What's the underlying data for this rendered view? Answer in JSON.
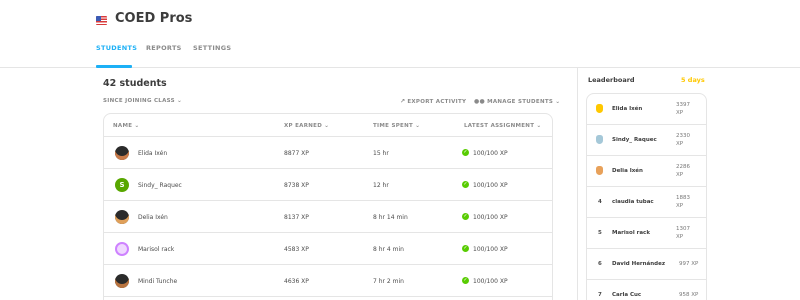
{
  "header": {
    "class_name": "COED Pros",
    "flag_icon": "us-flag-icon",
    "tabs": [
      "STUDENTS",
      "REPORTS",
      "SETTINGS"
    ],
    "active_tab": "STUDENTS"
  },
  "main": {
    "student_count": "42 students",
    "filter_label": "SINCE JOINING CLASS",
    "export_label": "EXPORT ACTIVITY",
    "manage_label": "MANAGE STUDENTS",
    "columns": [
      "NAME",
      "XP EARNED",
      "TIME SPENT",
      "LATEST ASSIGNMENT"
    ],
    "rows": [
      {
        "name": "Elida Ixén",
        "xp": "8877 XP",
        "time": "15 hr",
        "assignment": "100/100 XP",
        "avatar_color": "#2b2b2b"
      },
      {
        "name": "Sindy_ Raquec",
        "xp": "8738 XP",
        "time": "12 hr",
        "assignment": "100/100 XP",
        "avatar_color": "#58a700",
        "avatar_letter": "S"
      },
      {
        "name": "Delia Ixén",
        "xp": "8137 XP",
        "time": "8 hr 14 min",
        "assignment": "100/100 XP",
        "avatar_color": "#2b2b2b"
      },
      {
        "name": "Marisol rack",
        "xp": "4583 XP",
        "time": "8 hr 4 min",
        "assignment": "100/100 XP",
        "avatar_color": "#ce82ff"
      },
      {
        "name": "Mindi Tunche",
        "xp": "4636 XP",
        "time": "7 hr 2 min",
        "assignment": "100/100 XP",
        "avatar_color": "#2b2b2b"
      }
    ]
  },
  "leaderboard": {
    "title": "Leaderboard",
    "days": "5 days",
    "entries": [
      {
        "rank": "",
        "medal": "gold",
        "name": "Elida Ixén",
        "xp_value": "3397",
        "xp_unit": "XP"
      },
      {
        "rank": "",
        "medal": "silver",
        "name": "Sindy_ Raquec",
        "xp_value": "2330",
        "xp_unit": "XP"
      },
      {
        "rank": "",
        "medal": "bronze",
        "name": "Delia Ixén",
        "xp_value": "2286",
        "xp_unit": "XP"
      },
      {
        "rank": "4",
        "name": "claudia tubac",
        "xp_value": "1883",
        "xp_unit": "XP"
      },
      {
        "rank": "5",
        "name": "Marisol rack",
        "xp_value": "1307",
        "xp_unit": "XP"
      },
      {
        "rank": "6",
        "name": "David Hernández",
        "xp_value": "997 XP"
      },
      {
        "rank": "7",
        "name": "Carla Cuc",
        "xp_value": "958 XP"
      }
    ]
  },
  "colors": {
    "accent": "#1cb0f6",
    "success": "#58cc02",
    "gold": "#ffc800",
    "silver": "#a5c8d8",
    "bronze": "#e8a15a"
  }
}
